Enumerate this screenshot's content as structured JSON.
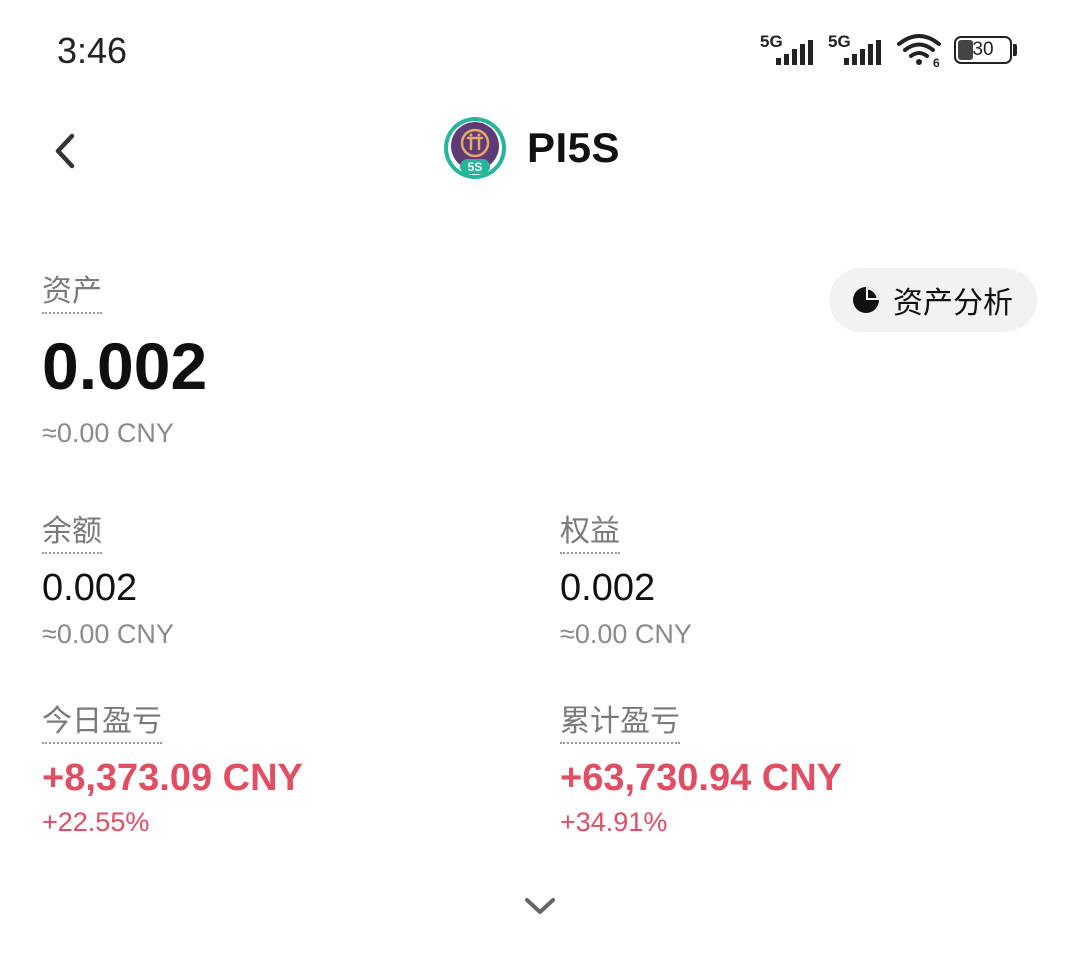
{
  "status_bar": {
    "time": "3:46",
    "signal1_label": "5G",
    "signal2_label": "5G",
    "wifi_label": "6",
    "battery": "30",
    "battery_level_percent": 30
  },
  "header": {
    "title": "PI5S",
    "logo_badge": "5S",
    "back_icon": "chevron-left-icon"
  },
  "assets": {
    "label": "资产",
    "value": "0.002",
    "approx": "≈0.00 CNY",
    "analysis_button": "资产分析",
    "analysis_icon": "pie-chart-icon"
  },
  "balance": {
    "label": "余额",
    "value": "0.002",
    "approx": "≈0.00 CNY"
  },
  "equity": {
    "label": "权益",
    "value": "0.002",
    "approx": "≈0.00 CNY"
  },
  "today_pnl": {
    "label": "今日盈亏",
    "value": "+8,373.09 CNY",
    "percent": "+22.55%"
  },
  "total_pnl": {
    "label": "累计盈亏",
    "value": "+63,730.94 CNY",
    "percent": "+34.91%"
  },
  "colors": {
    "profit": "#e04e63",
    "muted": "#8a8a8a",
    "text": "#111111",
    "chip_bg": "#f2f2f3"
  },
  "expand_icon": "chevron-down-icon"
}
